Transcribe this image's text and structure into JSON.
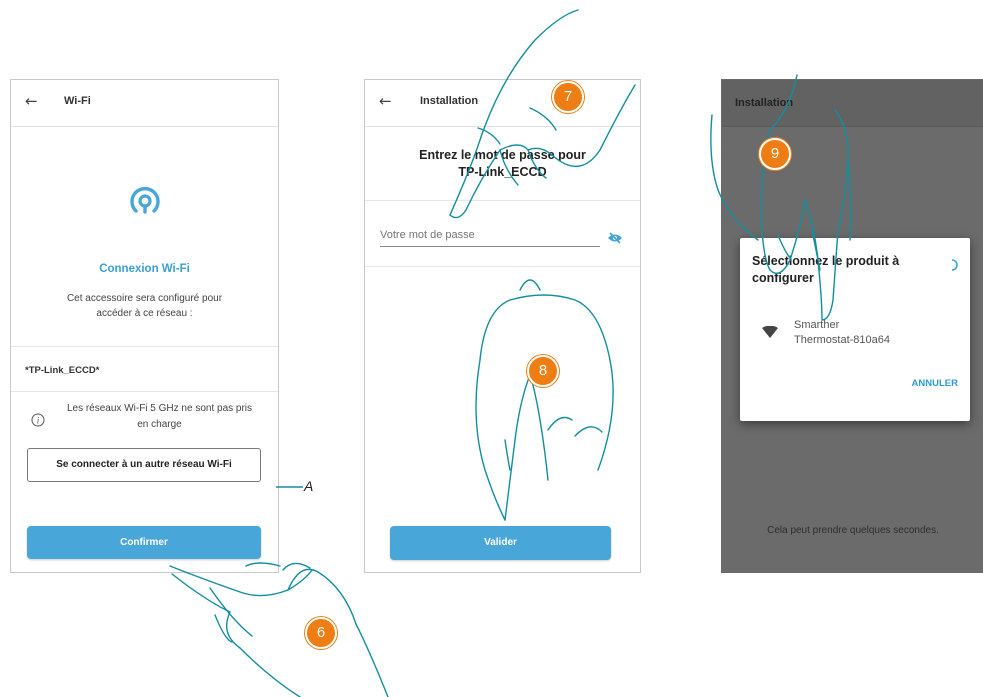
{
  "colors": {
    "accent": "#49a6d9",
    "step_badge": "#ee7d14",
    "hand_stroke": "#128f9f",
    "dark_overlay": "#6b6b6b"
  },
  "screen1": {
    "back_icon": "arrow-left-icon",
    "title": "Wi-Fi",
    "wifi_icon": "wifi-broadcast-icon",
    "heading": "Connexion Wi-Fi",
    "desc_line1": "Cet accessoire sera configuré pour",
    "desc_line2": "accéder à ce réseau :",
    "network": "*TP-Link_ECCD*",
    "info_icon": "info-icon",
    "note_line1": "Les réseaux Wi-Fi 5 GHz ne sont pas pris",
    "note_line2": "en charge",
    "other_network_button": "Se connecter à un autre réseau Wi-Fi",
    "confirm_button": "Confirmer",
    "callout_label": "A"
  },
  "screen2": {
    "back_icon": "arrow-left-icon",
    "title": "Installation",
    "prompt_line1": "Entrez le mot de passe pour",
    "prompt_line2": "TP-Link_ECCD",
    "password_placeholder": "Votre mot de passe",
    "eye_icon": "eye-off-icon",
    "validate_button": "Valider"
  },
  "screen3": {
    "title": "Installation",
    "dialog_title_line1": "Sélectionnez le produit à",
    "dialog_title_line2": "configurer",
    "spinner_icon": "spinner-icon",
    "wifi_icon": "wifi-signal-icon",
    "device_line1": "Smarther",
    "device_line2": "Thermostat-810a64",
    "cancel_button": "ANNULER",
    "footer_text": "Cela peut prendre quelques secondes."
  },
  "steps": [
    "6",
    "7",
    "8",
    "9"
  ]
}
